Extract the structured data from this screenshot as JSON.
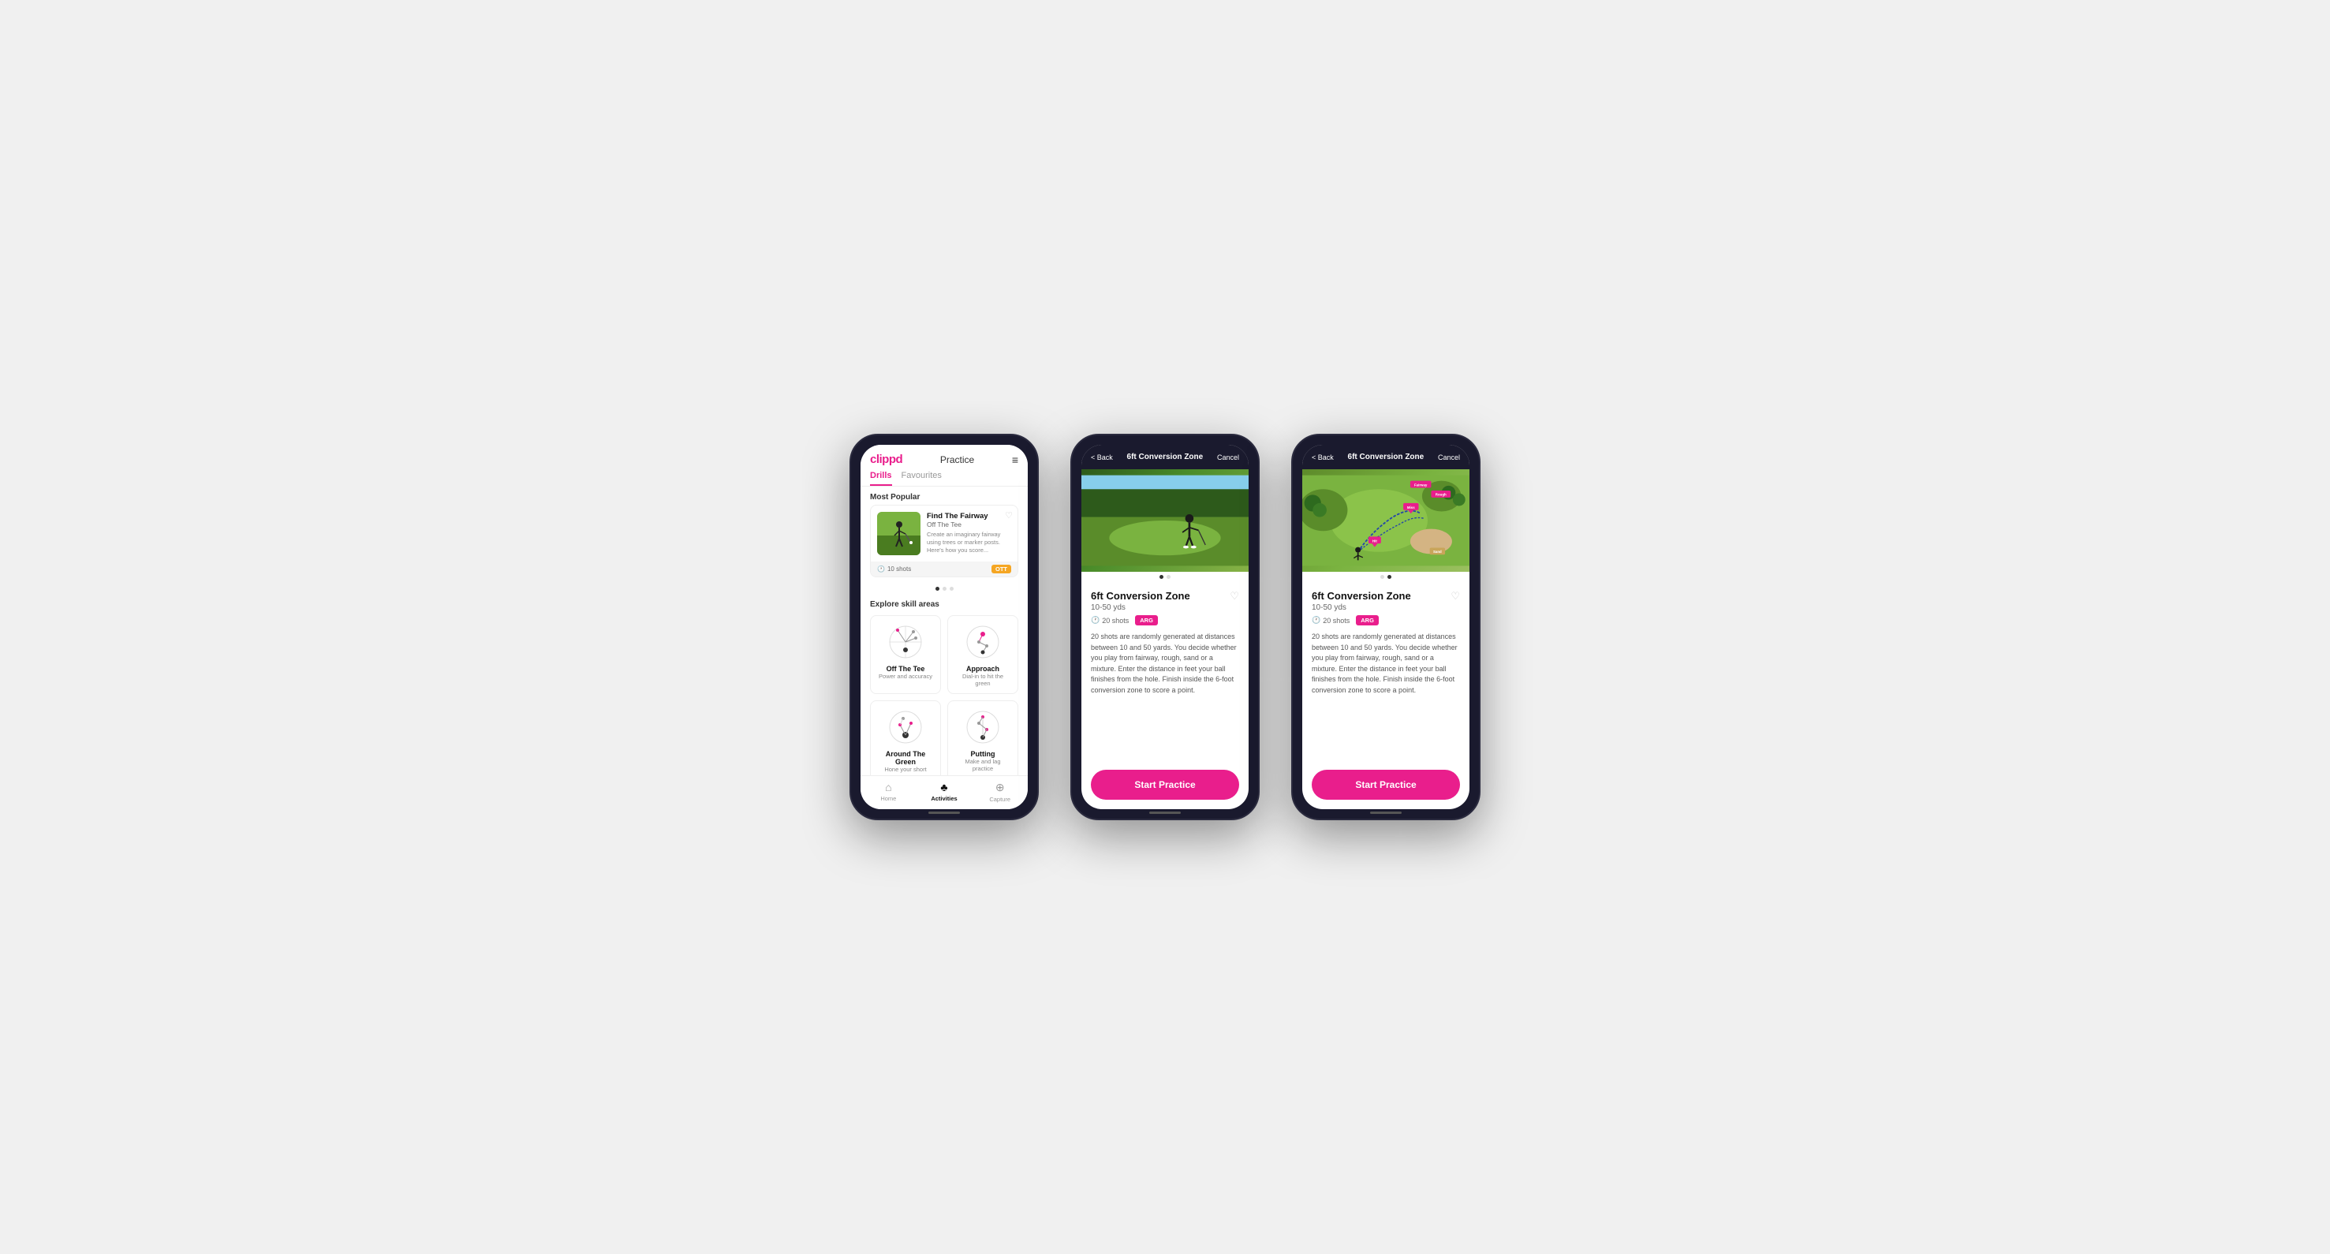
{
  "phones": {
    "phone1": {
      "header": {
        "logo": "clippd",
        "title": "Practice",
        "menu_icon": "≡"
      },
      "tabs": [
        {
          "label": "Drills",
          "active": true
        },
        {
          "label": "Favourites",
          "active": false
        }
      ],
      "most_popular": {
        "section_label": "Most Popular",
        "drill": {
          "name": "Find The Fairway",
          "category": "Off The Tee",
          "description": "Create an imaginary fairway using trees or marker posts. Here's how you score...",
          "shots": "10 shots",
          "tag": "OTT",
          "fav_icon": "♡"
        }
      },
      "explore": {
        "section_label": "Explore skill areas",
        "skills": [
          {
            "name": "Off The Tee",
            "desc": "Power and accuracy"
          },
          {
            "name": "Approach",
            "desc": "Dial-in to hit the green"
          },
          {
            "name": "Around The Green",
            "desc": "Hone your short game"
          },
          {
            "name": "Putting",
            "desc": "Make and lag practice"
          }
        ]
      },
      "bottom_nav": [
        {
          "label": "Home",
          "icon": "⌂",
          "active": false
        },
        {
          "label": "Activities",
          "icon": "♣",
          "active": true
        },
        {
          "label": "Capture",
          "icon": "⊕",
          "active": false
        }
      ]
    },
    "phone2": {
      "header": {
        "back_label": "< Back",
        "title": "6ft Conversion Zone",
        "cancel_label": "Cancel"
      },
      "drill": {
        "name": "6ft Conversion Zone",
        "range": "10-50 yds",
        "shots": "20 shots",
        "tag": "ARG",
        "fav_icon": "♡",
        "description": "20 shots are randomly generated at distances between 10 and 50 yards. You decide whether you play from fairway, rough, sand or a mixture. Enter the distance in feet your ball finishes from the hole. Finish inside the 6-foot conversion zone to score a point.",
        "start_btn": "Start Practice"
      },
      "image_type": "photo"
    },
    "phone3": {
      "header": {
        "back_label": "< Back",
        "title": "6ft Conversion Zone",
        "cancel_label": "Cancel"
      },
      "drill": {
        "name": "6ft Conversion Zone",
        "range": "10-50 yds",
        "shots": "20 shots",
        "tag": "ARG",
        "fav_icon": "♡",
        "description": "20 shots are randomly generated at distances between 10 and 50 yards. You decide whether you play from fairway, rough, sand or a mixture. Enter the distance in feet your ball finishes from the hole. Finish inside the 6-foot conversion zone to score a point.",
        "start_btn": "Start Practice"
      },
      "image_type": "map",
      "map_pins": [
        "Miss",
        "Hit"
      ],
      "map_labels": [
        "Fairway",
        "Rough",
        "Sand"
      ]
    }
  }
}
